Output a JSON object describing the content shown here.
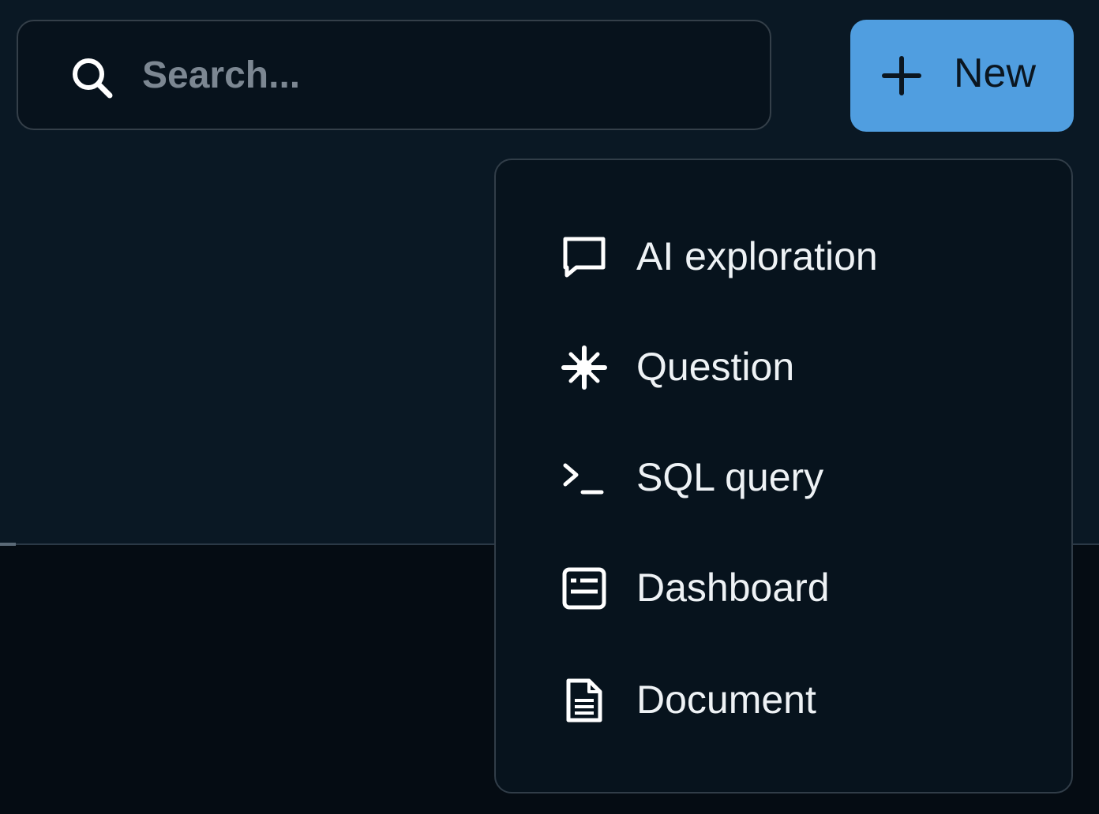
{
  "search": {
    "placeholder": "Search...",
    "value": ""
  },
  "new_button": {
    "label": "New"
  },
  "new_menu": {
    "items": [
      {
        "label": "AI exploration",
        "icon": "chat-bubble-icon"
      },
      {
        "label": "Question",
        "icon": "sparkle-icon"
      },
      {
        "label": "SQL query",
        "icon": "terminal-icon"
      },
      {
        "label": "Dashboard",
        "icon": "dashboard-icon"
      },
      {
        "label": "Document",
        "icon": "document-icon"
      }
    ]
  },
  "colors": {
    "accent": "#509ee0",
    "background": "#0a1824",
    "menu_background": "#07131d",
    "text": "#eef2f5",
    "placeholder": "#7c8792"
  }
}
